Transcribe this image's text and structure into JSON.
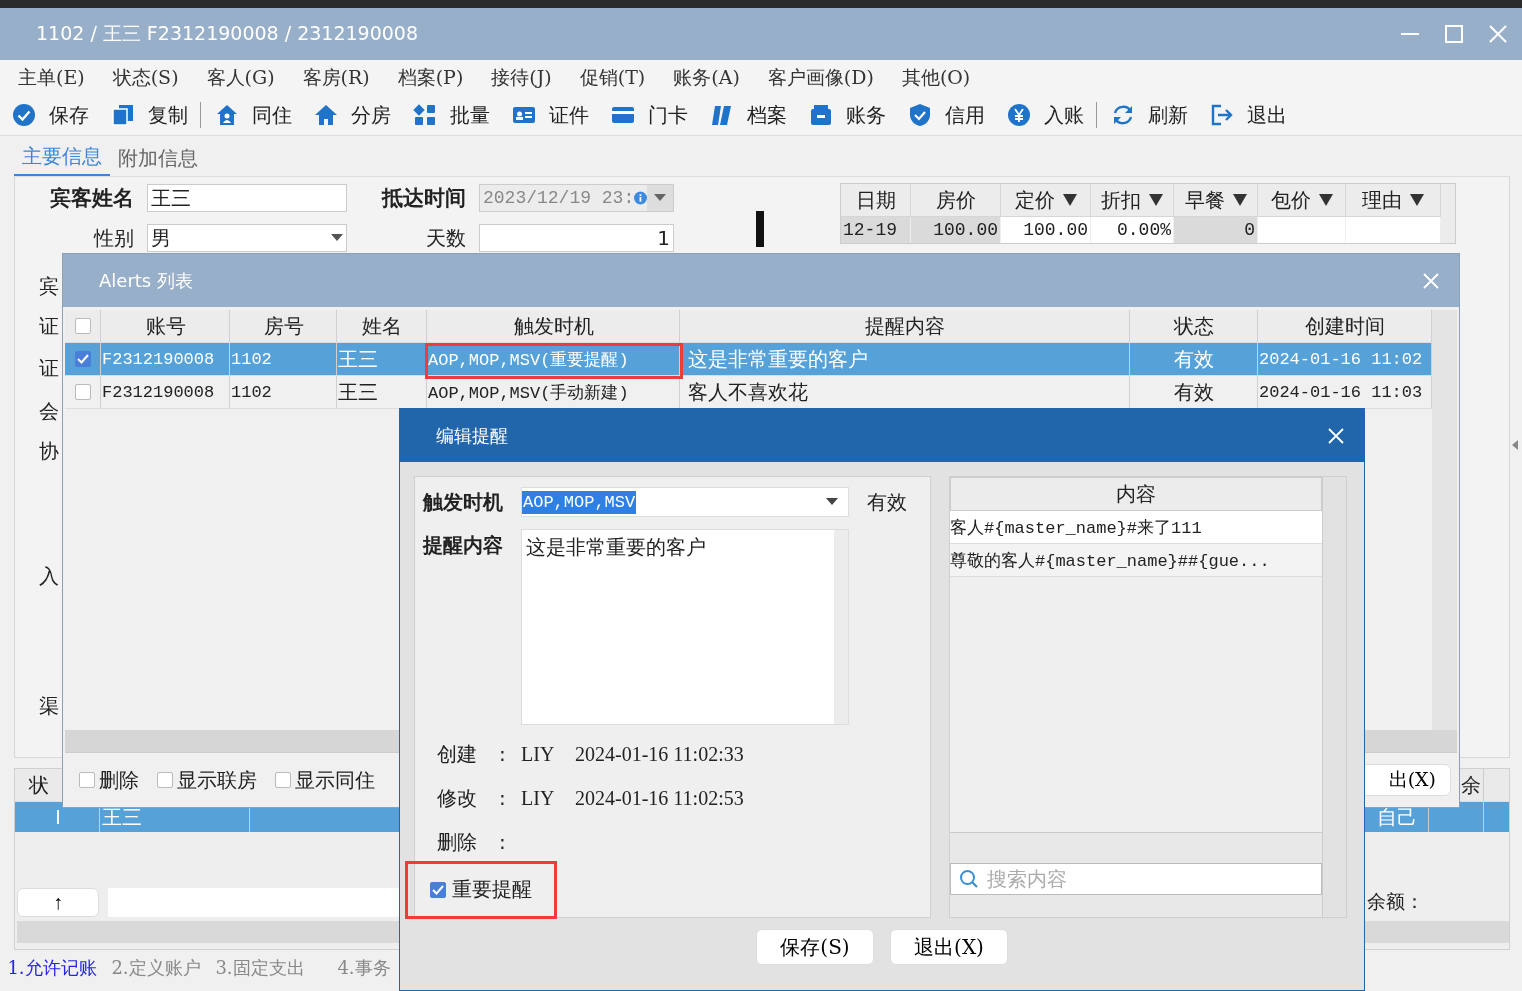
{
  "window": {
    "title": "1102 / 王三 F2312190008 / 2312190008"
  },
  "menu": [
    "主单(E)",
    "状态(S)",
    "客人(G)",
    "客房(R)",
    "档案(P)",
    "接待(J)",
    "促销(T)",
    "账务(A)",
    "客户画像(D)",
    "其他(O)"
  ],
  "toolbar": [
    {
      "label": "保存",
      "kind": "check",
      "divider_after": false
    },
    {
      "label": "复制",
      "kind": "copy",
      "divider_after": true
    },
    {
      "label": "同住",
      "kind": "house-person",
      "divider_after": false
    },
    {
      "label": "分房",
      "kind": "house",
      "divider_after": false
    },
    {
      "label": "批量",
      "kind": "grid",
      "divider_after": false
    },
    {
      "label": "证件",
      "kind": "idcard",
      "divider_after": false
    },
    {
      "label": "门卡",
      "kind": "card",
      "divider_after": false
    },
    {
      "label": "档案",
      "kind": "documents",
      "divider_after": false
    },
    {
      "label": "账务",
      "kind": "wallet",
      "divider_after": false
    },
    {
      "label": "信用",
      "kind": "shield",
      "divider_after": false
    },
    {
      "label": "入账",
      "kind": "coin",
      "divider_after": true
    },
    {
      "label": "刷新",
      "kind": "refresh",
      "divider_after": false
    },
    {
      "label": "退出",
      "kind": "exit",
      "divider_after": false
    }
  ],
  "tabs": [
    {
      "label": "主要信息",
      "selected": true
    },
    {
      "label": "附加信息",
      "selected": false
    }
  ],
  "form": {
    "guest_name_label": "宾客姓名",
    "guest_name": "王三",
    "arrival_label": "抵达时间",
    "arrival": "2023/12/19 23:",
    "gender_label": "性别",
    "gender": "男",
    "days_label": "天数",
    "days": "1"
  },
  "side_labels": [
    "宾",
    "证",
    "证",
    "会",
    "协",
    "入",
    "渠"
  ],
  "rate_grid": {
    "columns": [
      {
        "label": "日期",
        "filter": false,
        "editable": false
      },
      {
        "label": "房价",
        "filter": false,
        "editable": false
      },
      {
        "label": "定价",
        "filter": true,
        "editable": true
      },
      {
        "label": "折扣",
        "filter": true,
        "editable": true
      },
      {
        "label": "早餐",
        "filter": true,
        "editable": false
      },
      {
        "label": "包价",
        "filter": true,
        "editable": true
      },
      {
        "label": "理由",
        "filter": true,
        "editable": true
      }
    ],
    "rows": [
      {
        "cells": [
          "12-19",
          "100.00",
          "100.00",
          "0.00%",
          "0"
        ]
      }
    ]
  },
  "alerts_window": {
    "title": "Alerts 列表",
    "all_checked": false,
    "columns": [
      "账号",
      "房号",
      "姓名",
      "触发时机",
      "提醒内容",
      "状态",
      "创建时间"
    ],
    "rows": [
      {
        "selected": true,
        "checked": true,
        "annotated": true,
        "cells": [
          "F2312190008",
          "1102",
          "王三",
          "AOP,MOP,MSV(重要提醒)",
          "这是非常重要的客户",
          "有效",
          "2024-01-16 11:02"
        ]
      },
      {
        "selected": false,
        "checked": false,
        "annotated": false,
        "cells": [
          "F2312190008",
          "1102",
          "王三",
          "AOP,MOP,MSV(手动新建)",
          "客人不喜欢花",
          "有效",
          "2024-01-16 11:03"
        ]
      }
    ],
    "options": [
      {
        "label": "删除",
        "checked": false
      },
      {
        "label": "显示联房",
        "checked": false
      },
      {
        "label": "显示同住",
        "checked": false
      }
    ],
    "exit_button": "出(X)"
  },
  "edit_dialog": {
    "title": "编辑提醒",
    "trigger_label": "触发时机",
    "trigger": "AOP,MOP,MSV",
    "status": "有效",
    "content_label": "提醒内容",
    "content": "这是非常重要的客户",
    "meta": [
      {
        "label": "创建",
        "colon": ":",
        "user": "LIY",
        "time": "2024-01-16 11:02:33"
      },
      {
        "label": "修改",
        "colon": ":",
        "user": "LIY",
        "time": "2024-01-16 11:02:53"
      },
      {
        "label": "删除",
        "colon": ":"
      }
    ],
    "important": {
      "label": "重要提醒",
      "checked": true,
      "annotated": true
    },
    "templates": {
      "header": "内容",
      "rows": [
        {
          "text": "客人#{master_name}#来了111",
          "selected": true
        },
        {
          "text": "尊敬的客人#{master_name}##{gue...",
          "selected": false
        }
      ]
    },
    "search_placeholder": "搜索内容",
    "buttons": [
      "保存(S)",
      "退出(X)"
    ]
  },
  "lower_grid": {
    "header_left": "状",
    "header_right": "余",
    "rows": [
      {
        "selected": true,
        "cells": [
          "I",
          "王三",
          "自己"
        ]
      }
    ],
    "up_button": "↑",
    "balance_label": "余额："
  },
  "bottom_tabs": [
    {
      "label": "1.允许记账",
      "selected": true
    },
    {
      "label": "2.定义账户",
      "selected": false
    },
    {
      "label": "3.固定支出",
      "selected": false
    },
    {
      "label": "4.事务",
      "selected": false
    }
  ]
}
